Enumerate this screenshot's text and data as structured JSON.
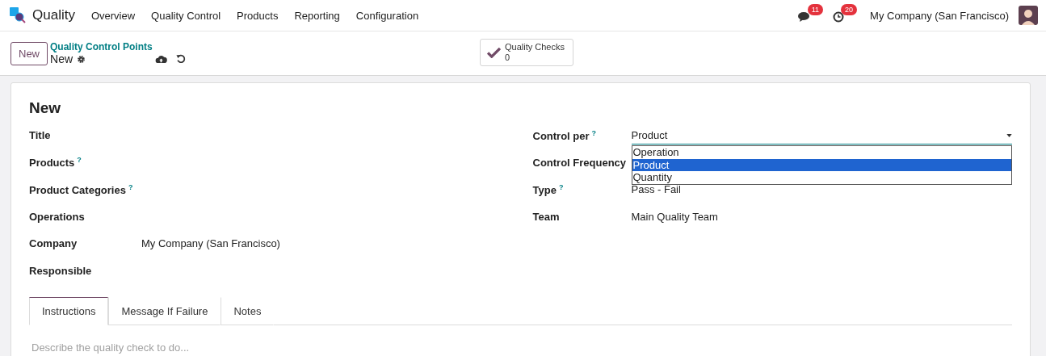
{
  "app": {
    "name": "Quality"
  },
  "menu": [
    "Overview",
    "Quality Control",
    "Products",
    "Reporting",
    "Configuration"
  ],
  "systray": {
    "messages_badge": "11",
    "activities_badge": "20",
    "company": "My Company (San Francisco)"
  },
  "control_panel": {
    "new_button": "New",
    "breadcrumb": "Quality Control Points",
    "record": "New",
    "smart_button": {
      "label": "Quality Checks",
      "count": "0"
    }
  },
  "form": {
    "title": "New",
    "left_fields": [
      {
        "label": "Title"
      },
      {
        "label": "Products",
        "help": "?"
      },
      {
        "label": "Product Categories",
        "help": "?"
      },
      {
        "label": "Operations"
      },
      {
        "label": "Company",
        "value": "My Company (San Francisco)"
      },
      {
        "label": "Responsible"
      }
    ],
    "right_fields": [
      {
        "label": "Control per",
        "help": "?",
        "value": "Product",
        "kind": "select"
      },
      {
        "label": "Control Frequency",
        "kind": "text"
      },
      {
        "label": "Type",
        "help": "?",
        "value": "Pass - Fail",
        "kind": "text"
      },
      {
        "label": "Team",
        "value": "Main Quality Team",
        "kind": "text"
      }
    ],
    "dropdown": {
      "options": [
        {
          "label": "Operation",
          "selected": false
        },
        {
          "label": "Product",
          "selected": true
        },
        {
          "label": "Quantity",
          "selected": false
        }
      ]
    },
    "tabs": [
      {
        "label": "Instructions",
        "selected": true
      },
      {
        "label": "Message If Failure",
        "selected": false
      },
      {
        "label": "Notes",
        "selected": false
      }
    ],
    "tab_content": {
      "placeholder": "Describe the quality check to do..."
    }
  }
}
